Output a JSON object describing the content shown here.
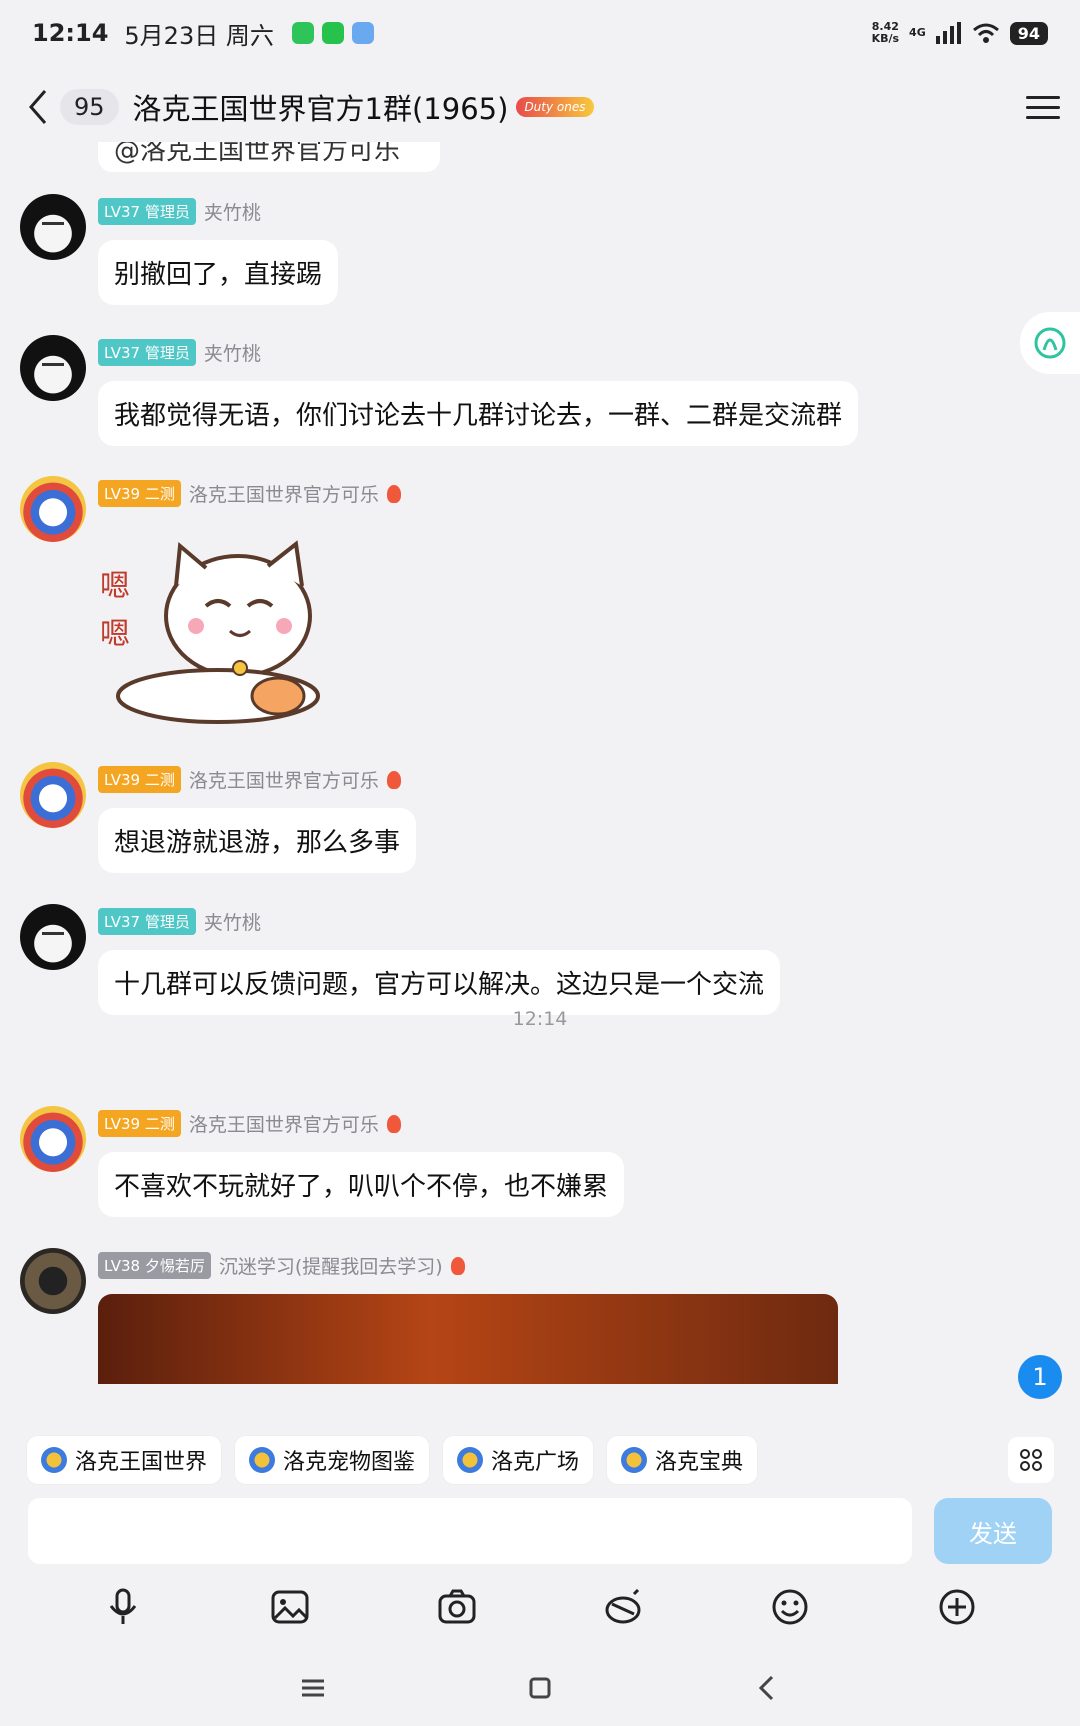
{
  "status": {
    "time": "12:14",
    "date": "5月23日 周六",
    "net_speed": "8.42\nKB/s",
    "network": "4G",
    "battery": "94"
  },
  "header": {
    "unread": "95",
    "title": "洛克王国世界官方1群(1965)",
    "tag": "Duty ones"
  },
  "clipped_message": "@洛克王国世界官方可乐",
  "messages": [
    {
      "level": "LV37 管理员",
      "nick": "夹竹桃",
      "text": "别撤回了，直接踢"
    },
    {
      "level": "LV37 管理员",
      "nick": "夹竹桃",
      "text": "我都觉得无语，你们讨论去十几群讨论去，一群、二群是交流群"
    },
    {
      "level": "LV39 二测",
      "nick": "洛克王国世界官方可乐",
      "sticker_text": "嗯嗯"
    },
    {
      "level": "LV39 二测",
      "nick": "洛克王国世界官方可乐",
      "text": "想退游就退游，那么多事"
    },
    {
      "level": "LV37 管理员",
      "nick": "夹竹桃",
      "text": "十几群可以反馈问题，官方可以解决。这边只是一个交流"
    },
    {
      "level": "LV39 二测",
      "nick": "洛克王国世界官方可乐",
      "text": "不喜欢不玩就好了，叭叭个不停，也不嫌累"
    },
    {
      "level": "LV38 夕惕若厉",
      "nick": "沉迷学习(提醒我回去学习)"
    }
  ],
  "time_divider": "12:14",
  "unread_float": "1",
  "shortcuts": [
    "洛克王国世界",
    "洛克宠物图鉴",
    "洛克广场",
    "洛克宝典"
  ],
  "input": {
    "value": "",
    "send_label": "发送"
  },
  "colors": {
    "admin": "#4fc7c6",
    "gold": "#f4a623",
    "send": "#9fd2f5",
    "badge": "#1a8cf0"
  }
}
